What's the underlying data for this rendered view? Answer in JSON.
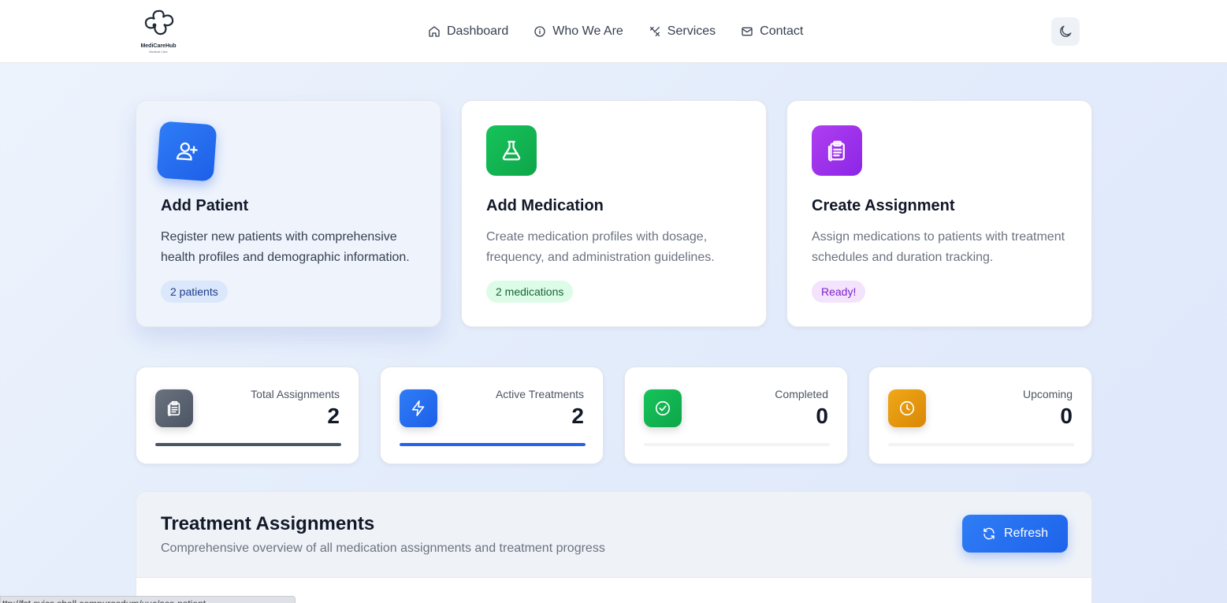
{
  "header": {
    "logo_name": "MediCareHub",
    "logo_tagline": "Medical Care",
    "nav": [
      {
        "label": "Dashboard",
        "icon": "home-icon"
      },
      {
        "label": "Who We Are",
        "icon": "info-icon"
      },
      {
        "label": "Services",
        "icon": "tools-icon"
      },
      {
        "label": "Contact",
        "icon": "mail-icon"
      }
    ],
    "theme_toggle_icon": "moon-icon"
  },
  "action_cards": [
    {
      "title": "Add Patient",
      "description": "Register new patients with comprehensive health profiles and demographic information.",
      "badge": "2 patients",
      "icon": "user-plus-icon",
      "color": "#2563eb"
    },
    {
      "title": "Add Medication",
      "description": "Create medication profiles with dosage, frequency, and administration guidelines.",
      "badge": "2 medications",
      "icon": "flask-icon",
      "color": "#16a34a"
    },
    {
      "title": "Create Assignment",
      "description": "Assign medications to patients with treatment schedules and duration tracking.",
      "badge": "Ready!",
      "icon": "clipboard-icon",
      "color": "#9333ea"
    }
  ],
  "stats": [
    {
      "label": "Total Assignments",
      "value": "2",
      "icon": "clipboard-icon",
      "progress": 1.0,
      "bar_color": "#4b5563"
    },
    {
      "label": "Active Treatments",
      "value": "2",
      "icon": "bolt-icon",
      "progress": 1.0,
      "bar_color": "#2563eb"
    },
    {
      "label": "Completed",
      "value": "0",
      "icon": "check-circle-icon",
      "progress": 0.0,
      "bar_color": "#16a34a"
    },
    {
      "label": "Upcoming",
      "value": "0",
      "icon": "clock-icon",
      "progress": 0.0,
      "bar_color": "#d97706"
    }
  ],
  "treatment": {
    "title": "Treatment Assignments",
    "subtitle": "Comprehensive overview of all medication assignments and treatment progress",
    "refresh_label": "Refresh",
    "refresh_icon": "refresh-icon"
  },
  "status_bar": {
    "url": "ttp://fst.svics.shell.compurasdum/uuc/ass-patient"
  }
}
